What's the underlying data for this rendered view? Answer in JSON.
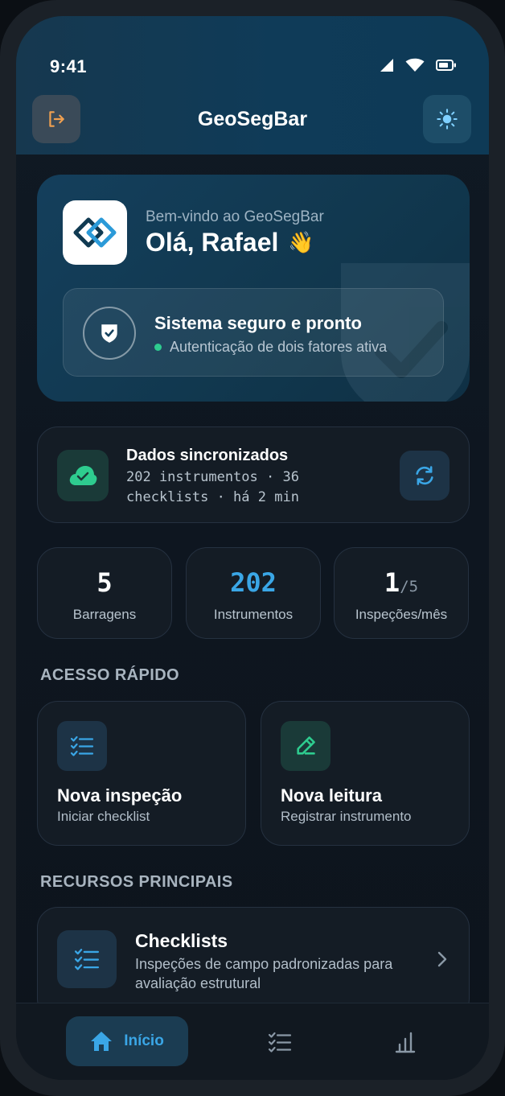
{
  "status_bar": {
    "time": "9:41"
  },
  "app_bar": {
    "title": "GeoSegBar"
  },
  "hero": {
    "welcome": "Bem-vindo ao GeoSegBar",
    "greeting": "Olá, Rafael",
    "wave_emoji": "👋",
    "security_title": "Sistema seguro e pronto",
    "security_status": "Autenticação de dois fatores ativa"
  },
  "sync": {
    "title": "Dados sincronizados",
    "subtitle": "202 instrumentos · 36 checklists · há 2 min"
  },
  "stats": [
    {
      "value": "5",
      "label": "Barragens"
    },
    {
      "value": "202",
      "label": "Instrumentos"
    },
    {
      "value": "1",
      "value_of": "/5",
      "label": "Inspeções/mês"
    }
  ],
  "quick_access": {
    "title": "ACESSO RÁPIDO",
    "items": [
      {
        "title": "Nova inspeção",
        "subtitle": "Iniciar checklist",
        "icon": "checklist-icon"
      },
      {
        "title": "Nova leitura",
        "subtitle": "Registrar instrumento",
        "icon": "pencil-icon"
      }
    ]
  },
  "features": {
    "title": "RECURSOS PRINCIPAIS",
    "items": [
      {
        "title": "Checklists",
        "description": "Inspeções de campo padronizadas para avaliação estrutural"
      }
    ]
  },
  "bottom_nav": {
    "items": [
      {
        "label": "Início",
        "icon": "home-icon",
        "active": true
      },
      {
        "label": "",
        "icon": "checklist-icon"
      },
      {
        "label": "",
        "icon": "bar-chart-icon"
      }
    ]
  },
  "colors": {
    "accent": "#3aa6e6",
    "success": "#2ecc8f",
    "card_bg": "#141c25",
    "header_bg": "#0f3b58"
  }
}
